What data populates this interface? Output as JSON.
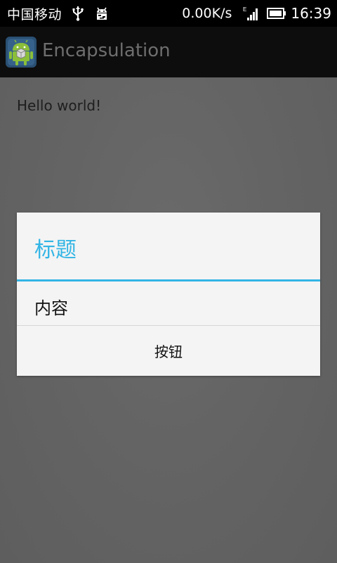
{
  "status_bar": {
    "carrier": "中国移动",
    "usb_icon": "usb-icon",
    "debug_icon": "android-debug-icon",
    "network_speed": "0.00K/s",
    "network_type": "E",
    "signal_icon": "signal-icon",
    "battery_icon": "battery-icon",
    "time": "16:39"
  },
  "action_bar": {
    "title": "Encapsulation",
    "app_icon": "android-app-icon"
  },
  "content": {
    "text": "Hello world!"
  },
  "dialog": {
    "title": "标题",
    "message": "内容",
    "button_label": "按钮",
    "accent_color": "#33b5e5"
  }
}
